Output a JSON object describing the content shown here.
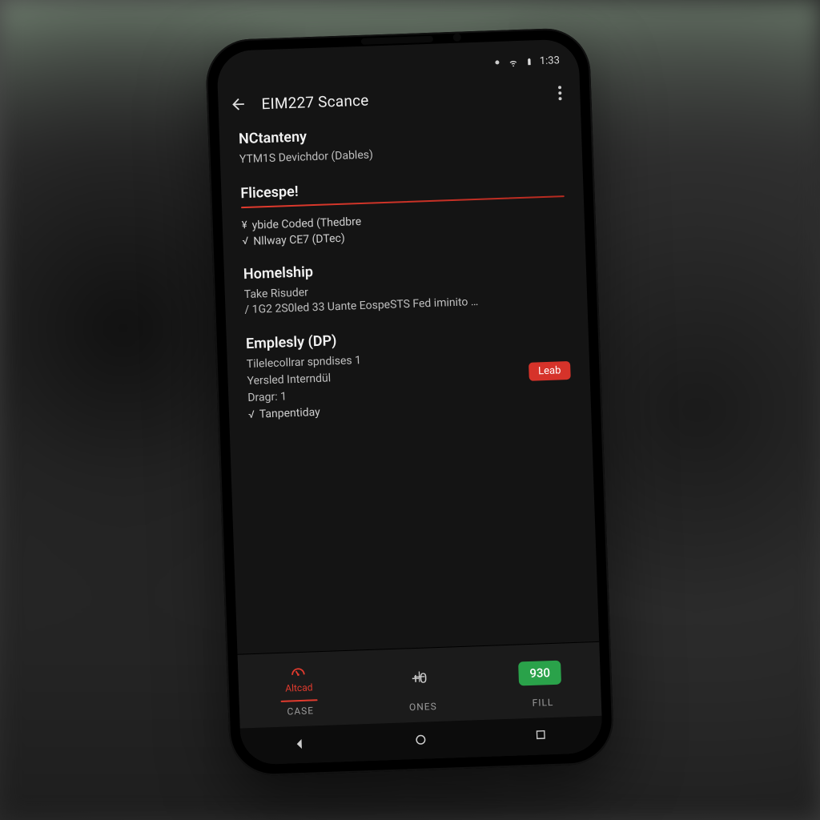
{
  "status_bar": {
    "time": "1:33",
    "icons": [
      "settings-dot",
      "wifi",
      "battery"
    ]
  },
  "app_bar": {
    "title": "EIM227 Scance"
  },
  "sections": [
    {
      "title": "NCtanteny",
      "subtitle": "YTM1S Devichdor (Dables)"
    },
    {
      "title": "Flicespe!",
      "divider": true,
      "items": [
        {
          "style": "yen",
          "text": "ybide Coded (Thedbre"
        },
        {
          "style": "v",
          "text": "Nllway CE7 (DTec)"
        }
      ]
    },
    {
      "title": "Homelship",
      "lines": [
        "Take Risuder",
        "/ 1G2 2S0led 33 Uante EospeSTS Fed iminito …"
      ]
    },
    {
      "title": "Emplesly (DP)",
      "lines": [
        "Tilelecollrar spndises 1",
        "Yersled Interndül",
        "Dragr: 1"
      ],
      "badge": "Leab",
      "trailing_check": {
        "style": "v",
        "text": "Tanpentiday"
      }
    }
  ],
  "tabs": {
    "items": [
      {
        "icon": "gauge-icon",
        "label": "Altcad",
        "active": true
      },
      {
        "icon": "plus-icon",
        "label": "+0"
      },
      {
        "icon": "pill-green",
        "label": "930"
      }
    ],
    "sub_labels": [
      "CASE",
      "ONES",
      "FILL"
    ]
  }
}
